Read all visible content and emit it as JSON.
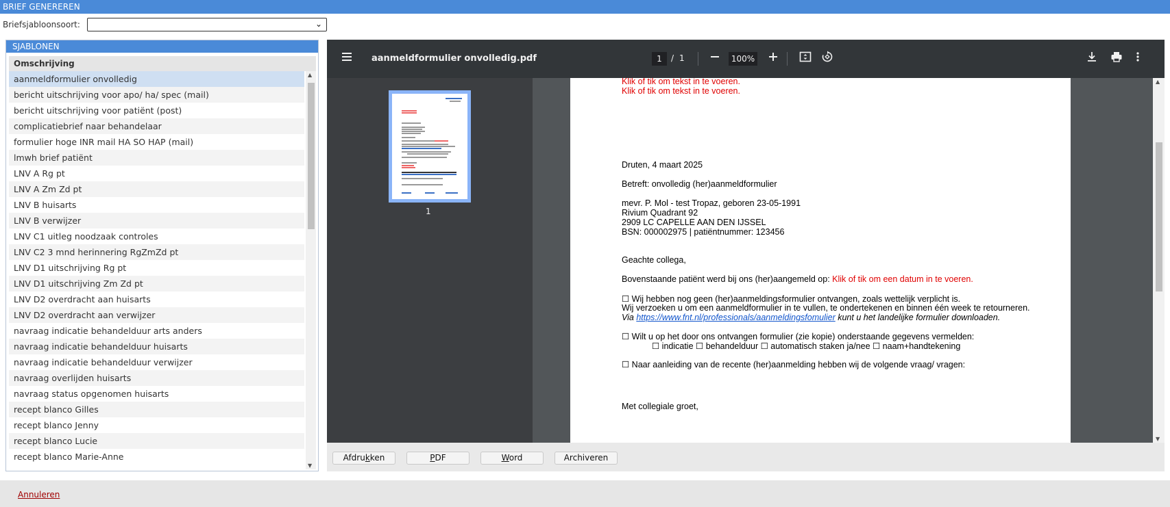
{
  "header": {
    "title": "BRIEF GENEREREN"
  },
  "type_select": {
    "label": "Briefsjabloonsoort:",
    "value": ""
  },
  "templates": {
    "panel_title": "SJABLONEN",
    "column_header": "Omschrijving",
    "items": [
      "aanmeldformulier onvolledig",
      "bericht uitschrijving voor apo/ ha/ spec (mail)",
      "bericht uitschrijving voor patiënt (post)",
      "complicatiebrief naar behandelaar",
      "formulier hoge INR mail HA SO HAP (mail)",
      "lmwh brief patiënt",
      "LNV A Rg pt",
      "LNV A Zm Zd pt",
      "LNV B huisarts",
      "LNV B verwijzer",
      "LNV C1 uitleg noodzaak controles",
      "LNV C2 3 mnd herinnering RgZmZd pt",
      "LNV D1 uitschrijving Rg pt",
      "LNV D1 uitschrijving Zm Zd pt",
      "LNV D2 overdracht aan huisarts",
      "LNV D2 overdracht aan verwijzer",
      "navraag indicatie behandelduur arts anders",
      "navraag indicatie behandelduur huisarts",
      "navraag indicatie behandelduur verwijzer",
      "navraag overlijden huisarts",
      "navraag status opgenomen huisarts",
      "recept blanco Gilles",
      "recept blanco Jenny",
      "recept blanco Lucie",
      "recept blanco Marie-Anne"
    ]
  },
  "pdf_viewer": {
    "filename": "aanmeldformulier onvolledig.pdf",
    "page_current": "1",
    "page_separator": "/",
    "page_total": "1",
    "zoom": "100%",
    "thumbnail_label": "1",
    "icons": [
      "menu-icon",
      "zoom-out-icon",
      "zoom-in-icon",
      "fit-page-icon",
      "rotate-icon",
      "download-icon",
      "print-icon",
      "more-icon"
    ]
  },
  "document": {
    "placeholder_1": "Klik of tik om tekst in te voeren.",
    "placeholder_2": "Klik of tik om tekst in te voeren.",
    "date_line": "Druten, 4 maart 2025",
    "subject": "Betreft: onvolledig (her)aanmeldformulier",
    "patient_name": "mevr. P. Mol - test Tropaz, geboren 23-05-1991",
    "address_1": "Rivium Quadrant 92",
    "address_2": "2909 LC  CAPELLE AAN DEN IJSSEL",
    "bsn_line": "BSN: 000002975 | patiëntnummer: 123456",
    "salutation": "Geachte collega,",
    "registered_prefix": "Bovenstaande patiënt werd bij ons (her)aangemeld op: ",
    "registered_placeholder": "Klik of tik om een datum in te voeren.",
    "option_1": "☐ Wij hebben nog geen (her)aanmeldingsformulier ontvangen, zoals wettelijk verplicht is.",
    "request_line": "Wij verzoeken u om een aanmeldformulier in te vullen, te ondertekenen en binnen één week te retourneren.",
    "via_prefix": "Via ",
    "via_link": "https://www.fnt.nl/professionals/aanmeldingsfomulier",
    "via_suffix": " kunt u het landelijke formulier downloaden.",
    "option_2": "☐ Wilt u op het door ons ontvangen formulier (zie kopie) onderstaande gegevens vermelden:",
    "option_2_sub": "☐ indicatie ☐ behandelduur ☐ automatisch staken ja/nee ☐ naam+handtekening",
    "option_3": "☐ Naar aanleiding van de recente (her)aanmelding hebben wij de volgende vraag/ vragen:",
    "closing": "Met collegiale groet,"
  },
  "actions": {
    "print_prefix": "Afdru",
    "print_mnemonic": "k",
    "print_suffix": "ken",
    "pdf_mnemonic": "P",
    "pdf_suffix": "DF",
    "word_mnemonic": "W",
    "word_suffix": "ord",
    "archive": "Archiveren"
  },
  "footer": {
    "cancel": "Annuleren"
  }
}
